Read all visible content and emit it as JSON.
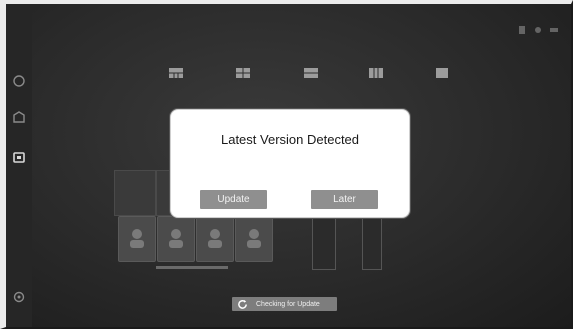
{
  "dialog": {
    "title": "Latest Version Detected",
    "update_label": "Update",
    "later_label": "Later"
  },
  "status": {
    "checking_text": "Checking for Update",
    "icon": "refresh-icon"
  },
  "sidebar": {
    "icons": [
      "home-icon",
      "photo-icon",
      "camera-icon",
      "settings-icon"
    ]
  },
  "mode_bar": {
    "icons": [
      "layout-grid-icon",
      "layout-split-icon",
      "layout-stack-icon",
      "layout-columns-icon",
      "layout-single-icon"
    ]
  },
  "colors": {
    "dialog_bg": "#ffffff",
    "button_bg": "#8f8f8f",
    "status_bg": "#7d7d7d"
  }
}
